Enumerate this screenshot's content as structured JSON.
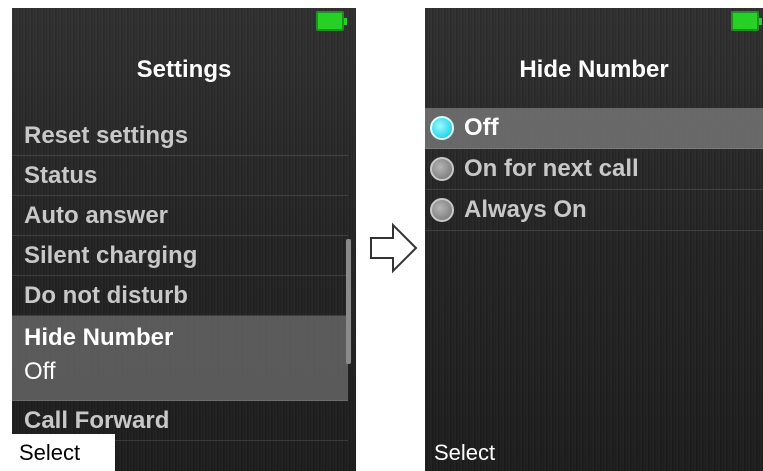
{
  "left_screen": {
    "title": "Settings",
    "menu_items": [
      "Reset settings",
      "Status",
      "Auto answer",
      "Silent charging",
      "Do not disturb"
    ],
    "selected_item": {
      "label": "Hide Number",
      "value": "Off"
    },
    "last_item": "Call Forward",
    "softkey": "Select"
  },
  "right_screen": {
    "title": "Hide Number",
    "options": [
      {
        "label": "Off",
        "selected": true
      },
      {
        "label": "On for next call",
        "selected": false
      },
      {
        "label": "Always On",
        "selected": false
      }
    ],
    "softkey": "Select"
  },
  "colors": {
    "battery": "#27d027",
    "radio_selected": "#3fe0ee",
    "radio_unselected": "#8e8e8e",
    "highlight": "#6e6e6e"
  },
  "icons": [
    "battery-icon",
    "radio-icon",
    "right-arrow-icon"
  ]
}
